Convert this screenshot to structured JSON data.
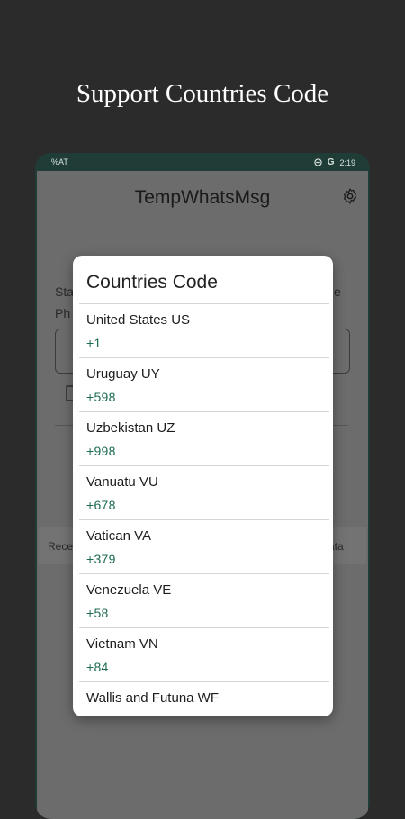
{
  "promo_title": "Support Countries Code",
  "status_bar": {
    "left_text": "%AT",
    "right_time": "2:19"
  },
  "app": {
    "title": "TempWhatsMsg"
  },
  "background": {
    "label1_left": "Sta",
    "label1_right": "e",
    "label2_left": "Ph",
    "tab_left": "Rece",
    "tab_right": "ata"
  },
  "dialog": {
    "title": "Countries Code",
    "items": [
      {
        "name": "United States US",
        "code": "+1"
      },
      {
        "name": "Uruguay UY",
        "code": "+598"
      },
      {
        "name": "Uzbekistan UZ",
        "code": "+998"
      },
      {
        "name": "Vanuatu VU",
        "code": "+678"
      },
      {
        "name": "Vatican VA",
        "code": "+379"
      },
      {
        "name": "Venezuela VE",
        "code": "+58"
      },
      {
        "name": "Vietnam VN",
        "code": "+84"
      },
      {
        "name": "Wallis and Futuna WF",
        "code": ""
      }
    ]
  },
  "colors": {
    "accent": "#1c6a52",
    "frame": "#1f3c37",
    "backdrop": "#2b2b2b"
  }
}
